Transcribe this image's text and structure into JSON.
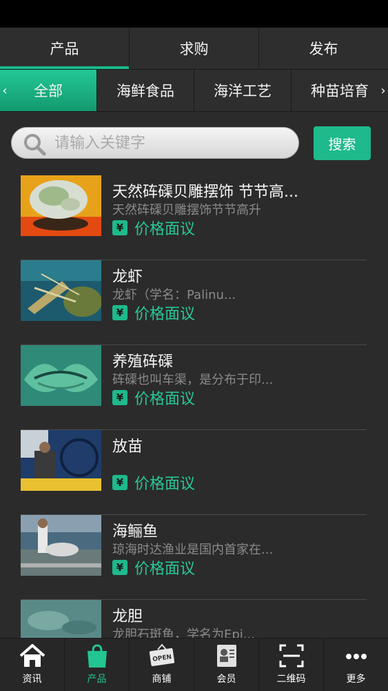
{
  "tabs": [
    {
      "label": "产品",
      "active": true
    },
    {
      "label": "求购",
      "active": false
    },
    {
      "label": "发布",
      "active": false
    }
  ],
  "categories": {
    "prev": "‹",
    "next": "›",
    "items": [
      {
        "label": "全部",
        "active": true
      },
      {
        "label": "海鲜食品",
        "active": false
      },
      {
        "label": "海洋工艺",
        "active": false
      },
      {
        "label": "种苗培育",
        "active": false
      }
    ]
  },
  "search": {
    "placeholder": "请输入关键字",
    "value": "",
    "button_label": "搜索"
  },
  "products": [
    {
      "title": "天然砗磲贝雕摆饰 节节高...",
      "desc": "天然砗磲贝雕摆饰节节高升",
      "price_icon": "¥",
      "price": "价格面议"
    },
    {
      "title": "龙虾",
      "desc": "龙虾（学名：Palinu...",
      "price_icon": "¥",
      "price": "价格面议"
    },
    {
      "title": "养殖砗磲",
      "desc": "砗磲也叫车渠，是分布于印...",
      "price_icon": "¥",
      "price": "价格面议"
    },
    {
      "title": "放苗",
      "desc": "",
      "price_icon": "¥",
      "price": "价格面议"
    },
    {
      "title": "海鲡鱼",
      "desc": "琼海时达渔业是国内首家在...",
      "price_icon": "¥",
      "price": "价格面议"
    },
    {
      "title": "龙胆",
      "desc": "龙胆石斑鱼，学名为Epi...",
      "price_icon": "¥",
      "price": ""
    }
  ],
  "bottom_nav": [
    {
      "label": "资讯",
      "icon": "home-icon",
      "active": false
    },
    {
      "label": "产品",
      "icon": "shopping-bag-icon",
      "active": true
    },
    {
      "label": "商铺",
      "icon": "open-sign-icon",
      "sign_text": "OPEN",
      "active": false
    },
    {
      "label": "会员",
      "icon": "member-card-icon",
      "active": false
    },
    {
      "label": "二维码",
      "icon": "qr-scan-icon",
      "active": false
    },
    {
      "label": "更多",
      "icon": "more-icon",
      "active": false
    }
  ],
  "colors": {
    "accent": "#1eb98c",
    "background": "#2b2b2b"
  }
}
